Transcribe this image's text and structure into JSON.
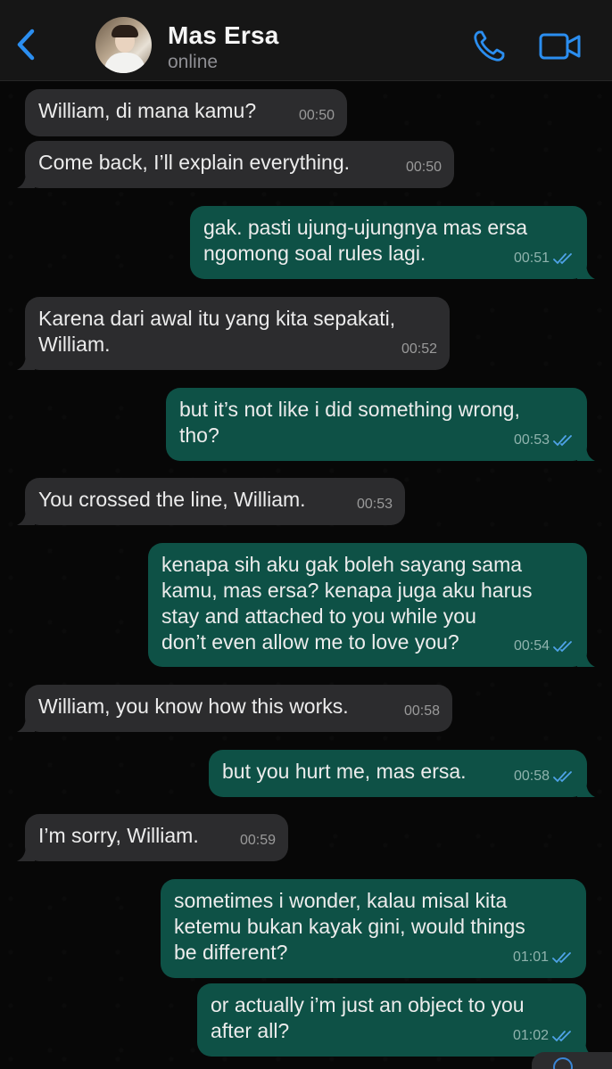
{
  "header": {
    "back_icon": "chevron-left-icon",
    "contact_name": "Mas Ersa",
    "status": "online",
    "call_icon": "phone-icon",
    "video_icon": "video-camera-icon",
    "accent_color": "#2b8ef0"
  },
  "messages": [
    {
      "dir": "in",
      "text": "William, di mana kamu?",
      "time": "00:50",
      "tail": false
    },
    {
      "dir": "in",
      "text": "Come back, I’ll explain everything.",
      "time": "00:50",
      "tail": true
    },
    {
      "dir": "out",
      "text": "gak. pasti ujung-ujungnya mas ersa\nngomong soal rules lagi.",
      "time": "00:51",
      "tail": true
    },
    {
      "dir": "in",
      "text": "Karena dari awal itu yang kita sepakati,\nWilliam.",
      "time": "00:52",
      "tail": true
    },
    {
      "dir": "out",
      "text": "but it’s not like i did something wrong,\ntho?",
      "time": "00:53",
      "tail": true
    },
    {
      "dir": "in",
      "text": "You crossed the line, William.",
      "time": "00:53",
      "tail": true
    },
    {
      "dir": "out",
      "text": "kenapa sih aku gak boleh sayang sama\nkamu, mas ersa? kenapa juga aku harus\nstay and attached to you while you\ndon’t even allow me to love you?",
      "time": "00:54",
      "tail": true
    },
    {
      "dir": "in",
      "text": "William, you know how this works.",
      "time": "00:58",
      "tail": true
    },
    {
      "dir": "out",
      "text": "but you hurt me, mas ersa.",
      "time": "00:58",
      "tail": true
    },
    {
      "dir": "in",
      "text": "I’m sorry, William.",
      "time": "00:59",
      "tail": true
    },
    {
      "dir": "out",
      "text": "sometimes i wonder, kalau misal kita\nketemu bukan kayak gini, would things\nbe different?",
      "time": "01:01",
      "tail": false
    },
    {
      "dir": "out",
      "text": "or actually i’m just an object to you\nafter all?",
      "time": "01:02",
      "tail": true
    }
  ],
  "colors": {
    "incoming_bubble": "#2c2c2e",
    "outgoing_bubble": "#0e5146",
    "read_ticks": "#4fa3e8"
  }
}
